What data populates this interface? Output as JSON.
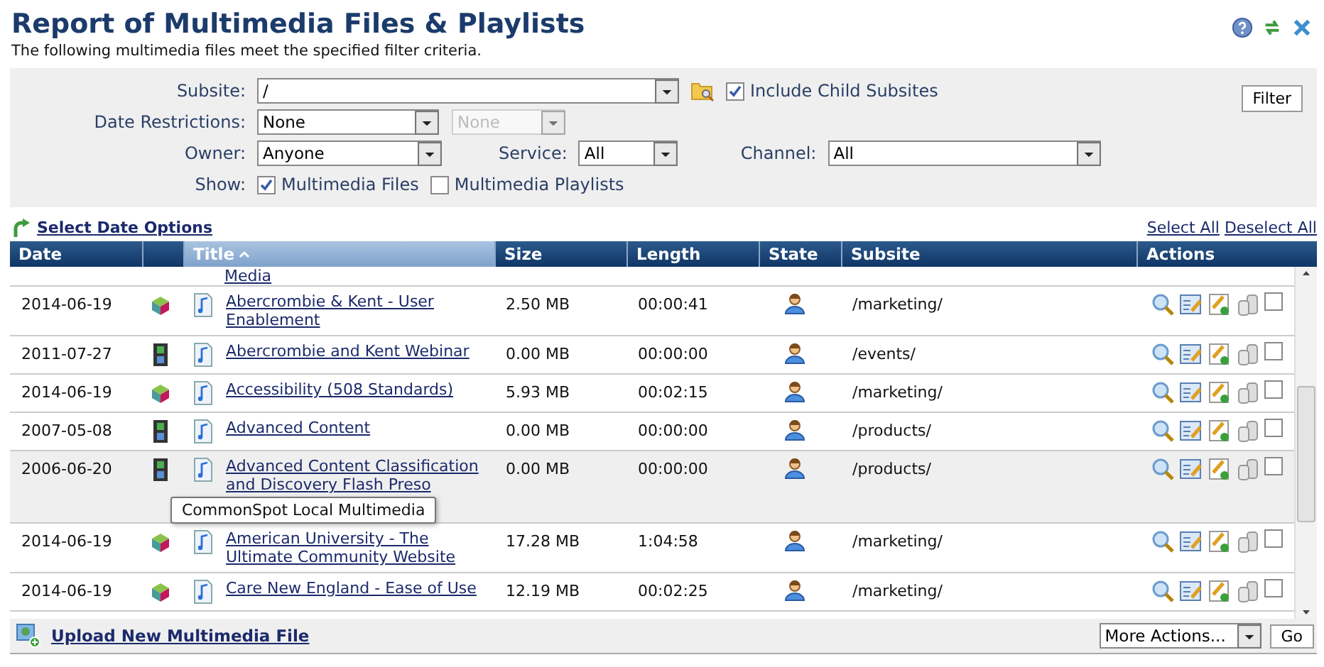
{
  "header": {
    "title": "Report of Multimedia Files & Playlists",
    "subtitle": "The following multimedia files meet the specified filter criteria."
  },
  "filters": {
    "subsite": {
      "label": "Subsite:",
      "value": "/"
    },
    "include_child": {
      "label": "Include Child Subsites",
      "checked": true
    },
    "filter_button": "Filter",
    "date_restrictions": {
      "label": "Date Restrictions:",
      "value": "None",
      "secondary": {
        "value": "None",
        "disabled": true
      }
    },
    "owner": {
      "label": "Owner:",
      "value": "Anyone"
    },
    "service": {
      "label": "Service:",
      "value": "All"
    },
    "channel": {
      "label": "Channel:",
      "value": "All"
    },
    "show": {
      "label": "Show:",
      "options": [
        {
          "label": "Multimedia Files",
          "checked": true
        },
        {
          "label": "Multimedia Playlists",
          "checked": false
        }
      ]
    }
  },
  "links": {
    "select_date_options": "Select Date Options",
    "select_all": "Select All",
    "deselect_all": "Deselect All"
  },
  "table": {
    "columns": [
      {
        "kind": "text",
        "label": "Date",
        "sorted": false
      },
      {
        "kind": "icon"
      },
      {
        "kind": "text",
        "label": "Title",
        "sorted": true
      },
      {
        "kind": "text",
        "label": "Size",
        "sorted": false
      },
      {
        "kind": "text",
        "label": "Length",
        "sorted": false
      },
      {
        "kind": "text",
        "label": "State",
        "sorted": false
      },
      {
        "kind": "text",
        "label": "Subsite",
        "sorted": false
      },
      {
        "kind": "text",
        "label": "Actions",
        "sorted": false
      }
    ],
    "partial_top_title": "Media",
    "rows": [
      {
        "kind": "cube",
        "date": "2014-06-19",
        "title": "Abercrombie & Kent - User Enablement",
        "size": "2.50 MB",
        "length": "00:00:41",
        "subsite": "/marketing/",
        "checked": false,
        "hovered": false
      },
      {
        "kind": "film",
        "date": "2011-07-27",
        "title": "Abercrombie and Kent Webinar",
        "size": "0.00 MB",
        "length": "00:00:00",
        "subsite": "/events/",
        "checked": false,
        "hovered": false
      },
      {
        "kind": "cube",
        "date": "2014-06-19",
        "title": "Accessibility (508 Standards)",
        "size": "5.93 MB",
        "length": "00:02:15",
        "subsite": "/marketing/",
        "checked": false,
        "hovered": false
      },
      {
        "kind": "film",
        "date": "2007-05-08",
        "title": "Advanced Content",
        "size": "0.00 MB",
        "length": "00:00:00",
        "subsite": "/products/",
        "checked": false,
        "hovered": false
      },
      {
        "kind": "film",
        "date": "2006-06-20",
        "title": "Advanced Content Classification and Discovery Flash Preso",
        "size": "0.00 MB",
        "length": "00:00:00",
        "subsite": "/products/",
        "checked": false,
        "hovered": true,
        "tooltip": "CommonSpot Local Multimedia"
      },
      {
        "kind": "cube",
        "date": "2014-06-19",
        "title": "American University - The Ultimate Community Website",
        "size": "17.28 MB",
        "length": "1:04:58",
        "subsite": "/marketing/",
        "checked": false,
        "hovered": false
      },
      {
        "kind": "cube",
        "date": "2014-06-19",
        "title": "Care New England - Ease of Use",
        "size": "12.19 MB",
        "length": "00:02:25",
        "subsite": "/marketing/",
        "checked": false,
        "hovered": false
      }
    ]
  },
  "footer": {
    "upload_link": "Upload New Multimedia File",
    "more_actions": "More Actions...",
    "go_button": "Go"
  }
}
